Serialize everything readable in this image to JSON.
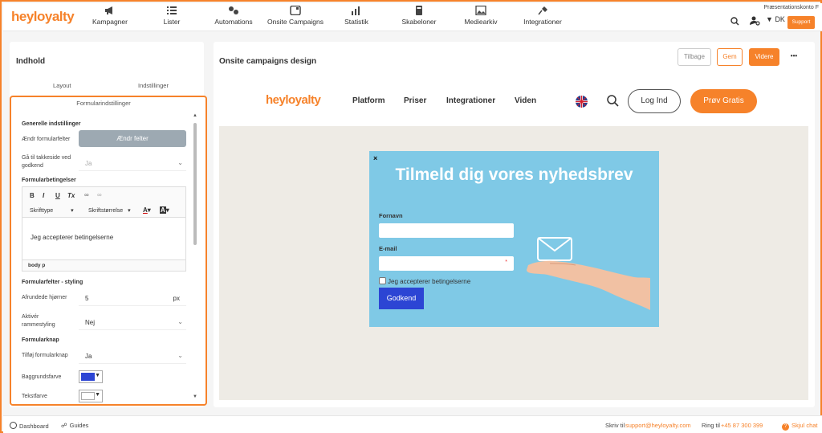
{
  "brand": {
    "logo": "heyloyalty",
    "accent": "#f6822a"
  },
  "topnav": {
    "items": [
      {
        "label": "Kampagner",
        "icon": "megaphone-icon"
      },
      {
        "label": "Lister",
        "icon": "list-icon"
      },
      {
        "label": "Automations",
        "icon": "automation-icon"
      },
      {
        "label": "Onsite Campaigns",
        "icon": "onsite-icon"
      },
      {
        "label": "Statistik",
        "icon": "chart-icon"
      },
      {
        "label": "Skabeloner",
        "icon": "template-icon"
      },
      {
        "label": "Mediearkiv",
        "icon": "image-icon"
      },
      {
        "label": "Integrationer",
        "icon": "plug-icon"
      }
    ],
    "account": "Præsentationskonto F",
    "language": "DK",
    "support": "Support"
  },
  "left": {
    "title": "Indhold",
    "tabs": [
      "Layout",
      "Indstillinger"
    ],
    "panel_title": "Formularindstillinger",
    "general_section": "Generelle indstillinger",
    "change_fields_label": "Ændr formularfelter",
    "change_fields_button": "Ændr felter",
    "thankyou_label_1": "Gå til takkeside ved",
    "thankyou_label_2": "godkend",
    "thankyou_value": "Ja",
    "conditions_section": "Formularbetingelser",
    "editor": {
      "font_type": "Skrifttype",
      "font_size": "Skriftstørrelse",
      "text": "Jeg accepterer betingelserne",
      "path": "body  p"
    },
    "styling_section": "Formularfelter - styling",
    "rounded_label": "Afrundede hjørner",
    "rounded_value": "5",
    "rounded_unit": "px",
    "border_label_1": "Aktivér",
    "border_label_2": "rammestyling",
    "border_value": "Nej",
    "button_section": "Formularknap",
    "add_button_label": "Tilføj formularknap",
    "add_button_value": "Ja",
    "bg_color_label": "Baggrundsfarve",
    "bg_color": "#2c45d4",
    "text_color_label": "Tekstfarve",
    "text_color": "#ffffff"
  },
  "right": {
    "title": "Onsite campaigns design",
    "back": "Tilbage",
    "save": "Gem",
    "next": "Videre",
    "more": "•••",
    "site": {
      "logo": "heyloyalty",
      "nav": [
        "Platform",
        "Priser",
        "Integrationer",
        "Viden"
      ],
      "login": "Log Ind",
      "try": "Prøv Gratis"
    },
    "popup": {
      "close": "×",
      "heading": "Tilmeld dig vores nyhedsbrev",
      "name_label": "Fornavn",
      "email_label": "E-mail",
      "required_mark": "*",
      "checkbox_label": "Jeg accepterer betingelserne",
      "submit": "Godkend",
      "bg": "#7fc9e6"
    }
  },
  "footer": {
    "dashboard": "Dashboard",
    "guides": "Guides",
    "write_to": "Skriv til",
    "email": "support@heyloyalty.com",
    "call_to": "Ring til",
    "phone": "+45 87 300 399",
    "hide_chat": "Skjul chat"
  }
}
